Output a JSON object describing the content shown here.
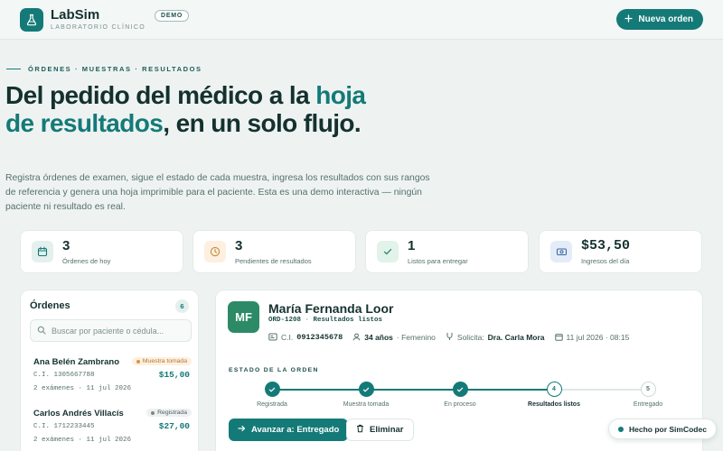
{
  "header": {
    "brand": "LabSim",
    "subtitle": "LABORATORIO CLÍNICO",
    "badge": "DEMO",
    "new_order_label": "Nueva orden"
  },
  "hero": {
    "eyebrow": "ÓRDENES · MUESTRAS · RESULTADOS",
    "title_part1": "Del pedido del médico a la ",
    "title_accent": "hoja de resultados",
    "title_part2": ", en un solo flujo.",
    "description": "Registra órdenes de examen, sigue el estado de cada muestra, ingresa los resultados con sus rangos de referencia y genera una hoja imprimible para el paciente. Esta es una demo interactiva — ningún paciente ni resultado es real."
  },
  "stats": [
    {
      "value": "3",
      "label": "Órdenes de hoy",
      "icon": "calendar-icon"
    },
    {
      "value": "3",
      "label": "Pendientes de resultados",
      "icon": "clock-icon"
    },
    {
      "value": "1",
      "label": "Listos para entregar",
      "icon": "check-icon"
    },
    {
      "value": "$53,50",
      "label": "Ingresos del día",
      "icon": "cash-icon"
    }
  ],
  "orders": {
    "title": "Órdenes",
    "count": "6",
    "search_placeholder": "Buscar por paciente o cédula...",
    "items": [
      {
        "name": "Ana Belén Zambrano",
        "status": "Muestra tomada",
        "ci": "C.I. 1305667788",
        "amount": "$15,00",
        "meta": "2 exámenes · 11 jul 2026"
      },
      {
        "name": "Carlos Andrés Villacís",
        "status": "Registrada",
        "ci": "C.I. 1712233445",
        "amount": "$27,00",
        "meta": "2 exámenes · 11 jul 2026"
      }
    ]
  },
  "detail": {
    "initials": "MF",
    "patient_name": "María Fernanda Loor",
    "order_id": "ORD-1208",
    "order_status": "Resultados listos",
    "ci_label": "C.I.",
    "ci_value": "0912345678",
    "age": "34 años",
    "sex": "· Femenino",
    "requester_label": "Solicita:",
    "requester": "Dra. Carla Mora",
    "date": "11 jul 2026 · 08:15",
    "state_section_label": "ESTADO DE LA ORDEN",
    "steps": [
      {
        "label": "Registrada",
        "mark": ""
      },
      {
        "label": "Muestra tomada",
        "mark": ""
      },
      {
        "label": "En proceso",
        "mark": ""
      },
      {
        "label": "Resultados listos",
        "mark": "4"
      },
      {
        "label": "Entregado",
        "mark": "5"
      }
    ],
    "advance_label": "Avanzar a: Entregado",
    "delete_label": "Eliminar"
  },
  "footer": {
    "made_by": "Hecho por SimCodec"
  },
  "colors": {
    "accent": "#147a78",
    "ink": "#14312e",
    "background": "#eef3f2"
  }
}
